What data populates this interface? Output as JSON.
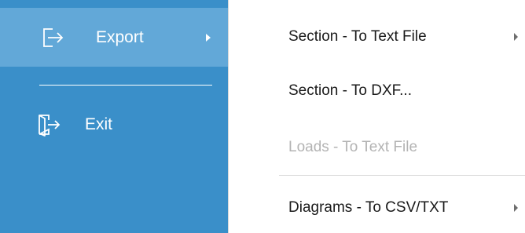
{
  "side_menu": {
    "items": [
      {
        "label": "Export",
        "icon": "export-icon",
        "has_submenu": true,
        "selected": true
      },
      {
        "label": "Exit",
        "icon": "exit-icon",
        "has_submenu": false,
        "selected": false
      }
    ],
    "background_color": "#3a8fc9",
    "selected_color": "#62a8d8"
  },
  "submenu": {
    "items": [
      {
        "label": "Section - To Text File",
        "enabled": true,
        "has_submenu": true
      },
      {
        "label": "Section - To DXF...",
        "enabled": true,
        "has_submenu": false
      },
      {
        "label": "Loads - To Text File",
        "enabled": false,
        "has_submenu": false
      },
      {
        "label": "Diagrams - To CSV/TXT",
        "enabled": true,
        "has_submenu": true
      }
    ]
  }
}
